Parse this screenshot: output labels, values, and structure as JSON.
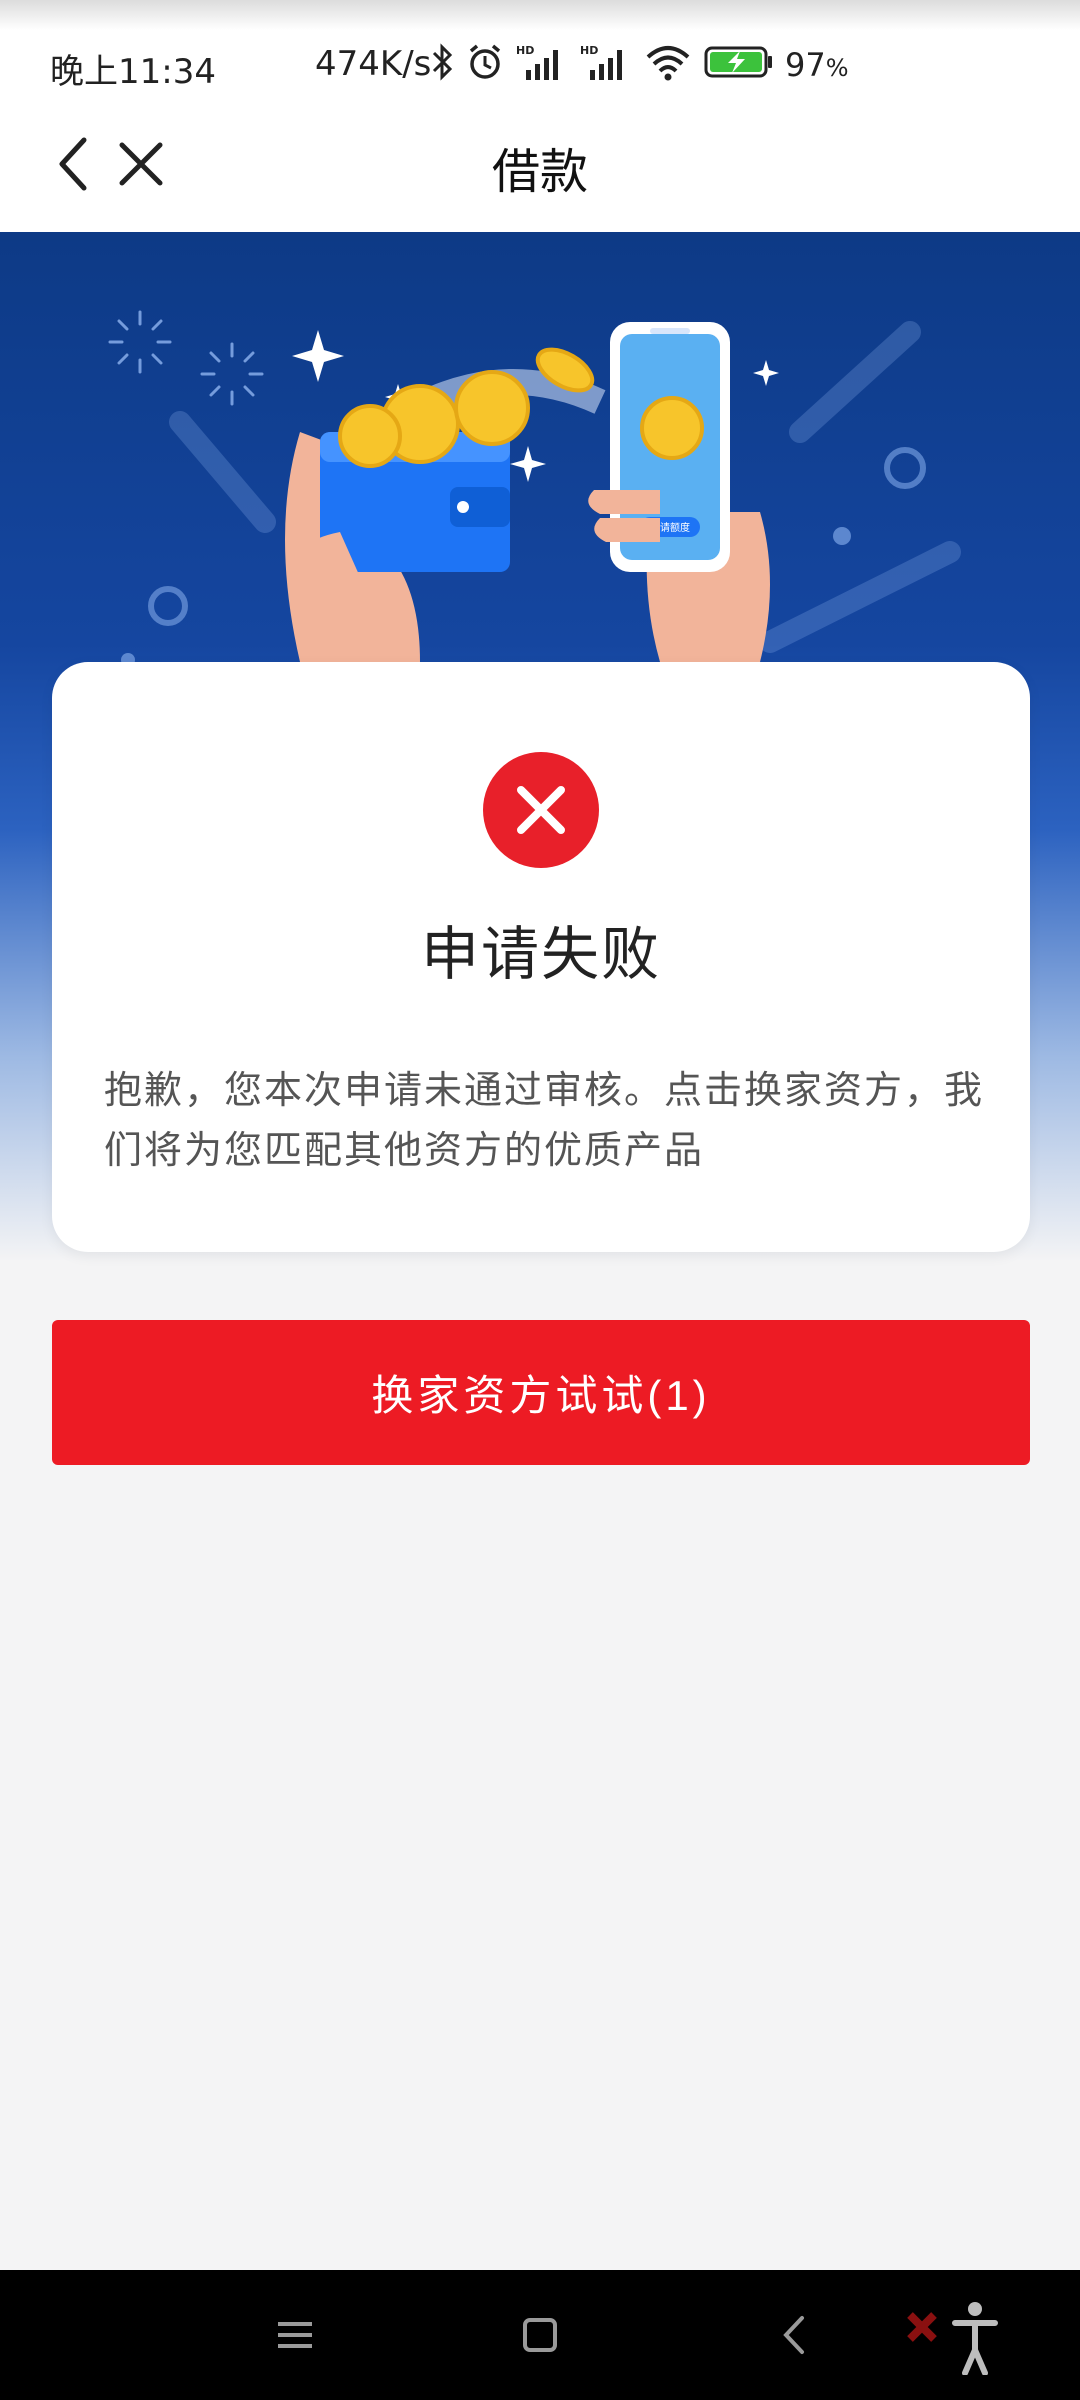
{
  "status_bar": {
    "time": "晚上11:34",
    "network_speed": "474K/s",
    "battery_percent": "97",
    "icons": [
      "bluetooth-icon",
      "alarm-icon",
      "signal-hd-icon",
      "signal-hd-icon",
      "wifi-icon",
      "battery-charging-icon"
    ]
  },
  "nav": {
    "title": "借款",
    "back_icon": "chevron-left-icon",
    "close_icon": "close-icon"
  },
  "hero": {
    "phone_button_text": "申请额度"
  },
  "result": {
    "status_icon": "error-x-icon",
    "title": "申请失败",
    "message": "抱歉，您本次申请未通过审核。点击换家资方，我们将为您匹配其他资方的优质产品"
  },
  "action": {
    "label": "换家资方试试(1)"
  },
  "colors": {
    "accent_red": "#ed1b24",
    "hero_blue": "#1546a0",
    "page_bg": "#f4f4f5"
  },
  "system_nav": {
    "menu_icon": "menu-icon",
    "home_icon": "home-square-icon",
    "back_icon": "back-chevron-icon",
    "accessibility_icon": "accessibility-icon"
  }
}
